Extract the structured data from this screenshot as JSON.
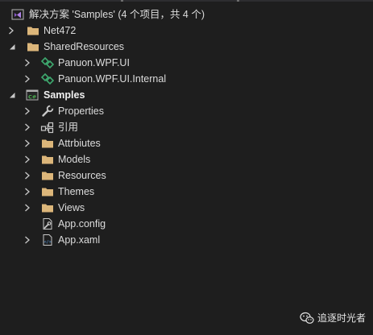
{
  "solution": {
    "title": "解决方案 'Samples' (4 个项目，共 4 个)"
  },
  "tree": {
    "net472": "Net472",
    "shared_resources": "SharedResources",
    "panuon_wpf_ui": "Panuon.WPF.UI",
    "panuon_wpf_ui_internal": "Panuon.WPF.UI.Internal",
    "samples": "Samples",
    "properties": "Properties",
    "references": "引用",
    "attributes": "Attrbiutes",
    "models": "Models",
    "resources": "Resources",
    "themes": "Themes",
    "views": "Views",
    "app_config": "App.config",
    "app_xaml": "App.xaml"
  },
  "watermark": {
    "text": "追逐时光者"
  },
  "colors": {
    "background": "#1e1e1e",
    "folder": "#dcb67a",
    "csharp_project": "#368832",
    "shared_project": "#3ea86e",
    "solution": "#8a5ac7"
  },
  "icons": {
    "solution": "visual-studio-solution-icon",
    "folder": "folder-icon",
    "shared": "shared-project-icon",
    "csharp": "csharp-project-icon",
    "wrench": "wrench-icon",
    "references": "references-icon",
    "config": "config-file-icon",
    "xaml": "xaml-file-icon"
  }
}
